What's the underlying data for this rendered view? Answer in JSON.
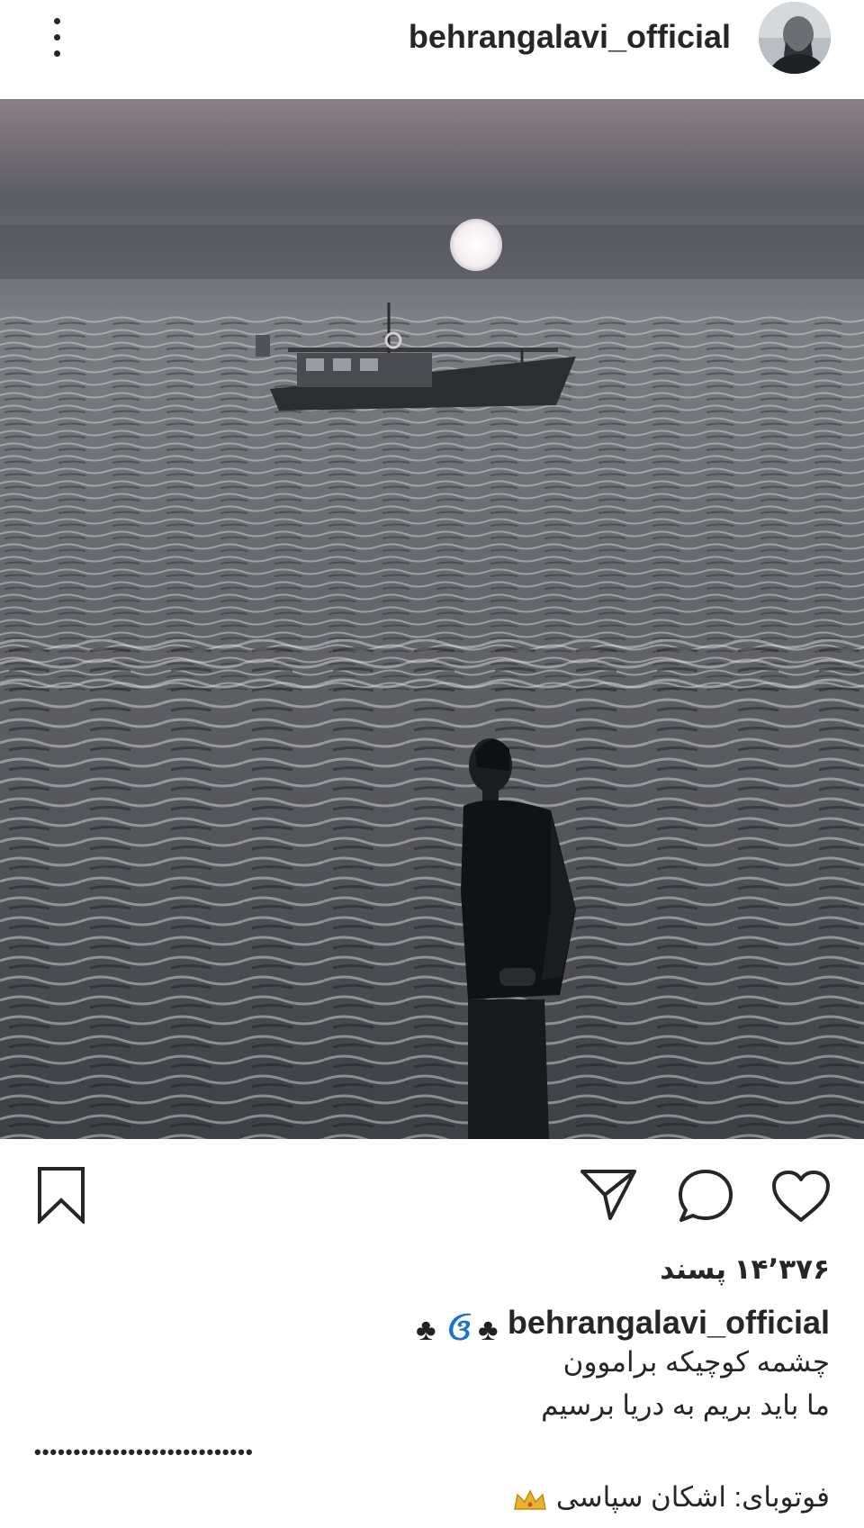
{
  "header": {
    "username": "behrangalavi_official",
    "more_icon": "three-dots-vertical-icon"
  },
  "post": {
    "photo_description": "Black and white seascape with sun, fishing boat and a man standing at the shore",
    "actions": {
      "like_icon": "heart-icon",
      "comment_icon": "comment-bubble-icon",
      "share_icon": "paper-plane-icon",
      "save_icon": "bookmark-icon"
    },
    "likes_text": "۱۴٬۳۷۶ پسند",
    "caption": {
      "username": "behrangalavi_official",
      "emojis": [
        "♣",
        "ઉ",
        "♣"
      ],
      "lines": [
        "چشمه کوچیکه براموون",
        "ما باید بریم به دریا برسیم"
      ],
      "separator": "••••••••••••••••••••••••••••",
      "credit": "فوتوبای: اشکان سپاسی"
    }
  }
}
